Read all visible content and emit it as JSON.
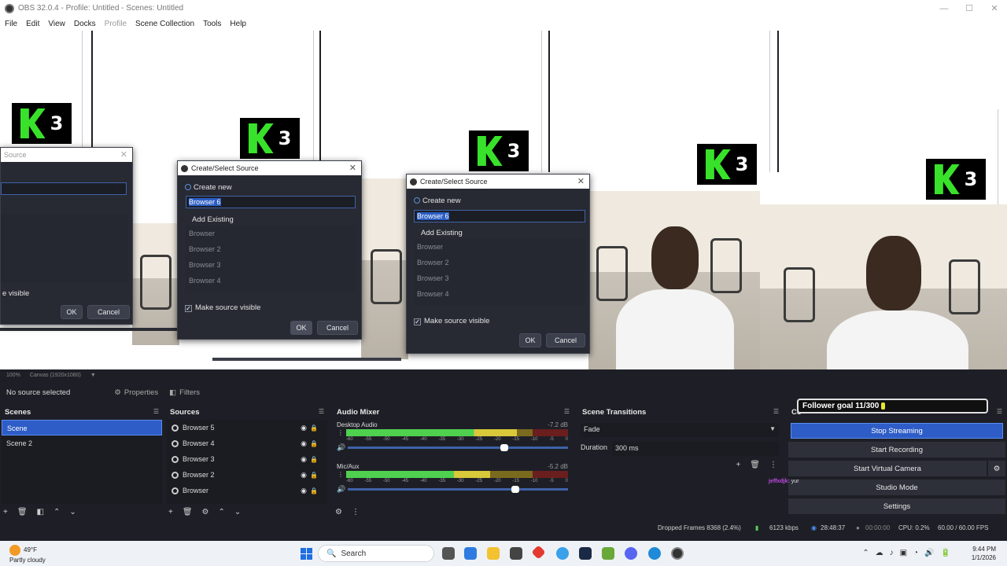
{
  "window": {
    "title": "OBS 32.0.4 - Profile: Untitled - Scenes: Untitled",
    "controls": [
      "—",
      "☐",
      "✕"
    ]
  },
  "menu": [
    "File",
    "Edit",
    "View",
    "Docks",
    "Profile",
    "Scene Collection",
    "Tools",
    "Help"
  ],
  "preview": {
    "logo_text": "3"
  },
  "dialog_left": {
    "title": "Source",
    "visible_label": "e visible",
    "ok": "OK",
    "cancel": "Cancel"
  },
  "dialog_mid": {
    "title": "Create/Select Source",
    "create_new": "Create new",
    "name_value": "Browser 6",
    "add_existing": "Add Existing",
    "existing": [
      "Browser",
      "Browser 2",
      "Browser 3",
      "Browser 4"
    ],
    "make_visible": "Make source visible",
    "ok": "OK",
    "cancel": "Cancel"
  },
  "dialog_right": {
    "title": "Create/Select Source",
    "create_new": "Create new",
    "name_value": "Browser 6",
    "add_existing": "Add Existing",
    "existing": [
      "Browser",
      "Browser 2",
      "Browser 3",
      "Browser 4"
    ],
    "make_visible": "Make source visible",
    "ok": "OK",
    "cancel": "Cancel"
  },
  "preview_toolbar": {
    "zoom": "100%",
    "canvas": "Canvas (1920x1080)"
  },
  "source_bar": {
    "status": "No source selected",
    "properties": "Properties",
    "filters": "Filters"
  },
  "scenes": {
    "header": "Scenes",
    "items": [
      "Scene",
      "Scene 2"
    ]
  },
  "sources": {
    "header": "Sources",
    "items": [
      "Browser 5",
      "Browser 4",
      "Browser 3",
      "Browser 2",
      "Browser"
    ]
  },
  "mixer": {
    "header": "Audio Mixer",
    "ticks": [
      "-60",
      "-55",
      "-50",
      "-45",
      "-40",
      "-35",
      "-30",
      "-25",
      "-20",
      "-15",
      "-10",
      "-5",
      "0"
    ],
    "channels": [
      {
        "name": "Desktop Audio",
        "db": "-7.2 dB",
        "level": 0.77,
        "volume": 0.71
      },
      {
        "name": "Mic/Aux",
        "db": "-5.2 dB",
        "level": 0.65,
        "volume": 0.76
      }
    ]
  },
  "transitions": {
    "header": "Scene Transitions",
    "selected": "Fade",
    "duration_label": "Duration",
    "duration_value": "300 ms"
  },
  "controls": {
    "header": "Co",
    "stop_streaming": "Stop Streaming",
    "start_recording": "Start Recording",
    "start_virtual_camera": "Start Virtual Camera",
    "studio_mode": "Studio Mode",
    "settings": "Settings"
  },
  "overlay": {
    "follower_goal": "Follower goal 11/300",
    "chat_user": "jeffxdjk:",
    "chat_msg": "yur"
  },
  "status": {
    "dropped": "Dropped Frames 8368 (2.4%)",
    "bitrate": "6123 kbps",
    "stream_time": "28:48:37",
    "rec_time": "00:00:00",
    "cpu": "CPU: 0.2%",
    "fps": "60.00 / 60.00 FPS"
  },
  "taskbar": {
    "temp": "49°F",
    "weather": "Partly cloudy",
    "search": "Search",
    "time": "9:44 PM",
    "date": "1/1/2026"
  }
}
